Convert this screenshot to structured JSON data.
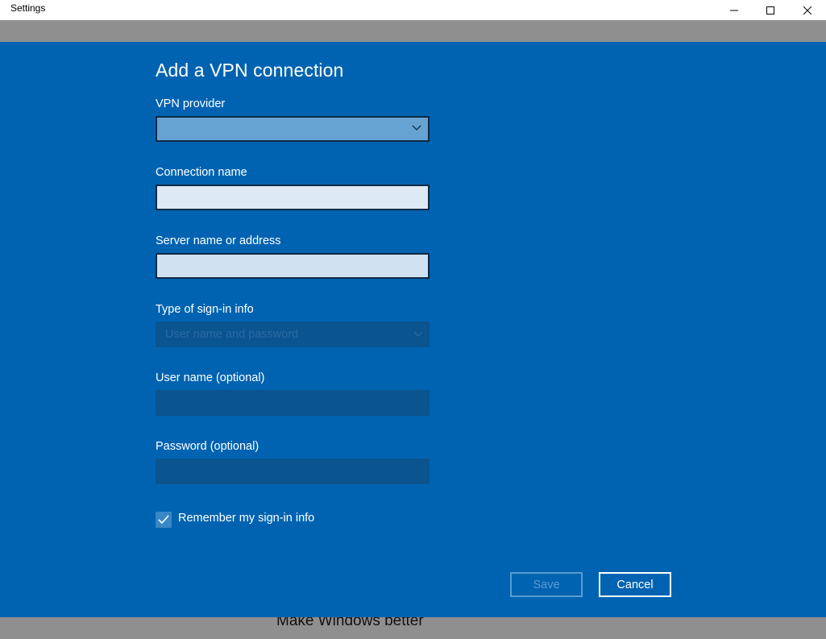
{
  "window": {
    "title": "Settings"
  },
  "background": {
    "partial_text": "Make Windows better"
  },
  "dialog": {
    "heading": "Add a VPN connection",
    "vpn_provider": {
      "label": "VPN provider",
      "value": ""
    },
    "connection_name": {
      "label": "Connection name",
      "value": ""
    },
    "server_name": {
      "label": "Server name or address",
      "value": ""
    },
    "sign_in_type": {
      "label": "Type of sign-in info",
      "value": "User name and password",
      "enabled": false
    },
    "user_name": {
      "label": "User name (optional)",
      "value": "",
      "enabled": false
    },
    "password": {
      "label": "Password (optional)",
      "value": "",
      "enabled": false
    },
    "remember": {
      "label": "Remember my sign-in info",
      "checked": true
    },
    "buttons": {
      "save": "Save",
      "cancel": "Cancel",
      "save_enabled": false
    }
  },
  "colors": {
    "dialog_bg": "#0063b1",
    "dropdown_active": "#66a3d2",
    "disabled_field": "#0a548f",
    "overlay": "#8f8f8f"
  },
  "icons": [
    "minimize-icon",
    "maximize-icon",
    "close-icon",
    "chevron-down-icon",
    "checkmark-icon"
  ]
}
